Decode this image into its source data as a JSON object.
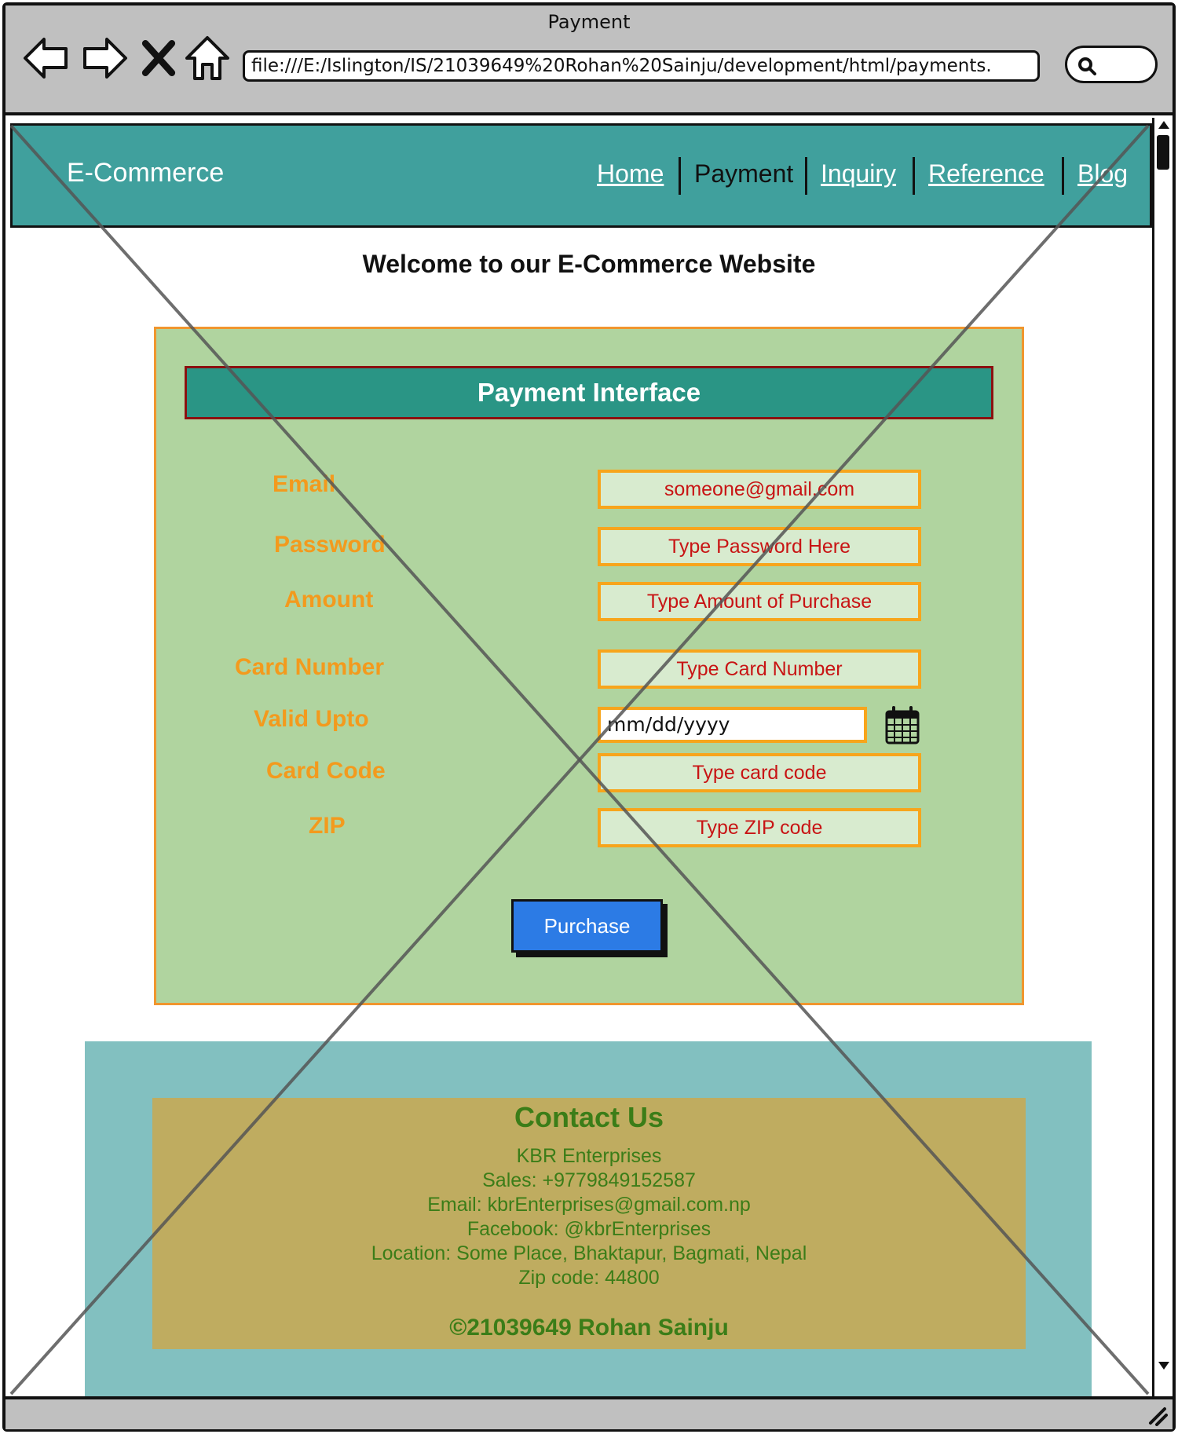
{
  "window": {
    "title": "Payment",
    "url": "file:///E:/Islington/IS/21039649%20Rohan%20Sainju/development/html/payments."
  },
  "header": {
    "brand": "E-Commerce",
    "nav": [
      {
        "label": "Home",
        "active": false
      },
      {
        "label": "Payment",
        "active": true
      },
      {
        "label": "Inquiry",
        "active": false
      },
      {
        "label": "Reference",
        "active": false
      },
      {
        "label": "Blog",
        "active": false
      }
    ]
  },
  "welcome": "Welcome to our E-Commerce Website",
  "form": {
    "title": "Payment Interface",
    "fields": [
      {
        "label": "Email",
        "placeholder": "someone@gmail.com"
      },
      {
        "label": "Password",
        "placeholder": "Type Password Here"
      },
      {
        "label": "Amount",
        "placeholder": "Type Amount of Purchase"
      },
      {
        "label": "Card Number",
        "placeholder": "Type Card Number"
      },
      {
        "label": "Valid Upto",
        "placeholder": "mm/dd/yyyy"
      },
      {
        "label": "Card Code",
        "placeholder": "Type card code"
      },
      {
        "label": "ZIP",
        "placeholder": "Type ZIP code"
      }
    ],
    "submit_label": "Purchase"
  },
  "footer": {
    "title": "Contact Us",
    "lines": [
      "KBR Enterprises",
      "Sales: +9779849152587",
      "Email: kbrEnterprises@gmail.com.np",
      "Facebook: @kbrEnterprises",
      "Location: Some Place, Bhaktapur, Bagmati, Nepal",
      "Zip code: 44800"
    ],
    "copyright": "©21039649 Rohan Sainju"
  },
  "colors": {
    "header": "#40a09d",
    "panel": "#b0d49f",
    "panel_border": "#f0962e",
    "label": "#f39a1d",
    "placeholder": "#c81414",
    "button": "#2c7be5",
    "footer": "#82c0c0",
    "contact_box": "#bfac60",
    "contact_text": "#3b7d18"
  },
  "icons": [
    "back-arrow-icon",
    "forward-arrow-icon",
    "close-icon",
    "home-icon",
    "search-icon",
    "calendar-icon",
    "resize-grip-icon"
  ]
}
